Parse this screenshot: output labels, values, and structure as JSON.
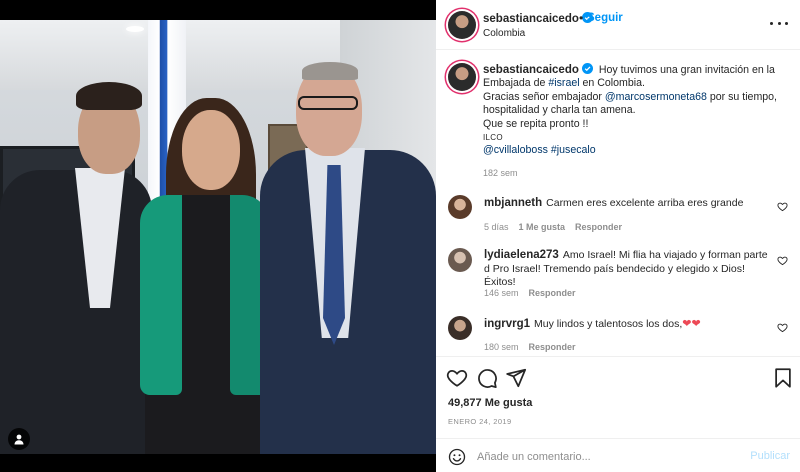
{
  "post": {
    "username": "sebastiancaicedo",
    "follow_label": "Seguir",
    "separator": "•",
    "location": "Colombia",
    "more_icon": "more-options-icon"
  },
  "caption": {
    "username": "sebastiancaicedo",
    "line1": "Hoy tuvimos una gran invitación en la Embajada de ",
    "hashtag_israel": "#israel",
    "line1_end": " en Colombia.",
    "line2_start": "Gracias señor embajador ",
    "mention_ambassador": "@marcosermoneta68",
    "line2_end": " por su tiempo, hospitalidad y charla tan amena.",
    "line3": "Que se repita pronto !!",
    "line4": "ILCO",
    "mention_credit": "@cvillaloboss",
    "hashtag_jusecalo": "#jusecalo",
    "time": "182 sem"
  },
  "comments": [
    {
      "username": "mbjanneth",
      "text": "Carmen eres excelente arriba eres grande",
      "time": "5 días",
      "likes": "1 Me gusta",
      "reply": "Responder"
    },
    {
      "username": "lydiaelena273",
      "text": "Amo Israel! Mi flia ha viajado y forman parte d Pro Israel! Tremendo país bendecido y elegido x Dios! Éxitos!",
      "time": "146 sem",
      "reply": "Responder"
    },
    {
      "username": "ingrvrg1",
      "text": "Muy lindos y talentosos los dos,",
      "hearts": "❤❤",
      "time": "180 sem",
      "reply": "Responder"
    }
  ],
  "actions": {
    "likes": "49,877 Me gusta",
    "date": "ENERO 24, 2019"
  },
  "add_comment": {
    "placeholder": "Añade un comentario...",
    "post_label": "Publicar"
  },
  "colors": {
    "accent": "#0095f6",
    "link": "#00376b",
    "muted": "#8e8e8e",
    "heart_red": "#ed4956",
    "jacket_green": "#169a7a"
  }
}
